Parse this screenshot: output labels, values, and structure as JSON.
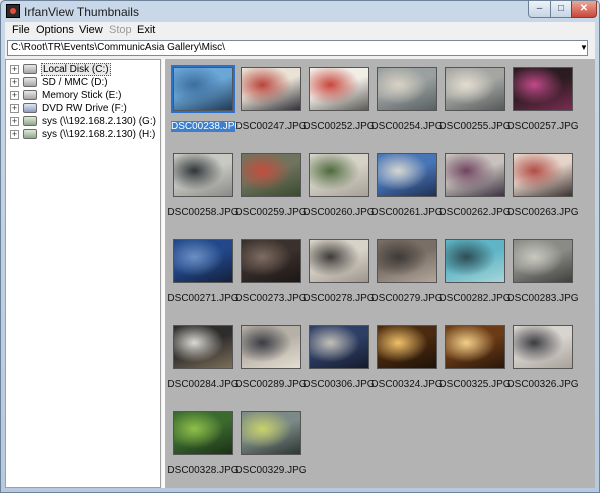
{
  "window": {
    "title": "IrfanView Thumbnails",
    "controls": {
      "minimize": "–",
      "maximize": "□",
      "close": "✕"
    }
  },
  "menu": [
    {
      "label": "File",
      "enabled": true
    },
    {
      "label": "Options",
      "enabled": true
    },
    {
      "label": "View",
      "enabled": true
    },
    {
      "label": "Stop",
      "enabled": false
    },
    {
      "label": "Exit",
      "enabled": true
    }
  ],
  "path": {
    "value": "C:\\Root\\TR\\Events\\CommunicAsia Gallery\\Misc\\",
    "dropdown_icon": "chevron-down-icon"
  },
  "tree": [
    {
      "label": "Local Disk (C:)",
      "icon": "hard-drive-icon",
      "selected": true
    },
    {
      "label": "SD / MMC (D:)",
      "icon": "removable-drive-icon",
      "selected": false
    },
    {
      "label": "Memory Stick (E:)",
      "icon": "removable-drive-icon",
      "selected": false
    },
    {
      "label": "DVD RW Drive (F:)",
      "icon": "dvd-drive-icon",
      "selected": false
    },
    {
      "label": "sys (\\\\192.168.2.130) (G:)",
      "icon": "network-drive-icon",
      "selected": false
    },
    {
      "label": "sys (\\\\192.168.2.130) (H:)",
      "icon": "network-drive-icon",
      "selected": false
    }
  ],
  "thumbnails": [
    {
      "name": "DSC00238.JPG",
      "selected": true,
      "colors": [
        "#6aa7d6",
        "#3d6d9e",
        "#203a58"
      ]
    },
    {
      "name": "DSC00247.JPG",
      "selected": false,
      "colors": [
        "#e9e2d5",
        "#b9433a",
        "#2f2f38"
      ]
    },
    {
      "name": "DSC00252.JPG",
      "selected": false,
      "colors": [
        "#f1eee8",
        "#c8463c",
        "#5c5a56"
      ]
    },
    {
      "name": "DSC00254.JPG",
      "selected": false,
      "colors": [
        "#9aa0a0",
        "#d8d2c4",
        "#585f62"
      ]
    },
    {
      "name": "DSC00255.JPG",
      "selected": false,
      "colors": [
        "#a4a6a2",
        "#e3ddd0",
        "#55595a"
      ]
    },
    {
      "name": "DSC00257.JPG",
      "selected": false,
      "colors": [
        "#2a1c20",
        "#c24a8a",
        "#7c2c52"
      ]
    },
    {
      "name": "DSC00258.JPG",
      "selected": false,
      "colors": [
        "#c9c9c4",
        "#2f3437",
        "#8a8b86"
      ]
    },
    {
      "name": "DSC00259.JPG",
      "selected": false,
      "colors": [
        "#6f745f",
        "#c34d3c",
        "#3c4a2e"
      ]
    },
    {
      "name": "DSC00260.JPG",
      "selected": false,
      "colors": [
        "#d6d2c7",
        "#4d6a3d",
        "#a5a196"
      ]
    },
    {
      "name": "DSC00261.JPG",
      "selected": false,
      "colors": [
        "#4875b6",
        "#d7d6d0",
        "#1f2f55"
      ]
    },
    {
      "name": "DSC00262.JPG",
      "selected": false,
      "colors": [
        "#c7c2bd",
        "#6f4460",
        "#3c3140"
      ]
    },
    {
      "name": "DSC00263.JPG",
      "selected": false,
      "colors": [
        "#e5d4c9",
        "#b14c45",
        "#3b3230"
      ]
    },
    {
      "name": "DSC00271.JPG",
      "selected": false,
      "colors": [
        "#22488a",
        "#6c8fc4",
        "#13203c"
      ]
    },
    {
      "name": "DSC00273.JPG",
      "selected": false,
      "colors": [
        "#3a302c",
        "#7d6c61",
        "#1b1614"
      ]
    },
    {
      "name": "DSC00278.JPG",
      "selected": false,
      "colors": [
        "#d8d3c9",
        "#3d3a37",
        "#9c958b"
      ]
    },
    {
      "name": "DSC00279.JPG",
      "selected": false,
      "colors": [
        "#7a6f66",
        "#3f3a37",
        "#b2a69a"
      ]
    },
    {
      "name": "DSC00282.JPG",
      "selected": false,
      "colors": [
        "#5fb4c5",
        "#2e4e55",
        "#a6d6da"
      ]
    },
    {
      "name": "DSC00283.JPG",
      "selected": false,
      "colors": [
        "#8a8b86",
        "#c8c8c0",
        "#3f403d"
      ]
    },
    {
      "name": "DSC00284.JPG",
      "selected": false,
      "colors": [
        "#2f2d2c",
        "#dcdad3",
        "#7d6e5a"
      ]
    },
    {
      "name": "DSC00289.JPG",
      "selected": false,
      "colors": [
        "#b7b0a6",
        "#3a3c44",
        "#e4ded2"
      ]
    },
    {
      "name": "DSC00306.JPG",
      "selected": false,
      "colors": [
        "#2e3f66",
        "#c3c0b8",
        "#151b2c"
      ]
    },
    {
      "name": "DSC00324.JPG",
      "selected": false,
      "colors": [
        "#4a2a10",
        "#f0c06a",
        "#1e1208"
      ]
    },
    {
      "name": "DSC00325.JPG",
      "selected": false,
      "colors": [
        "#6b3b16",
        "#f2d08a",
        "#2a170a"
      ]
    },
    {
      "name": "DSC00326.JPG",
      "selected": false,
      "colors": [
        "#d8d4cf",
        "#3a3a40",
        "#a7a19a"
      ]
    },
    {
      "name": "DSC00328.JPG",
      "selected": false,
      "colors": [
        "#3a6a2e",
        "#8fbf4a",
        "#1c3016"
      ]
    },
    {
      "name": "DSC00329.JPG",
      "selected": false,
      "colors": [
        "#7b8a86",
        "#c9d26a",
        "#2d3634"
      ]
    }
  ]
}
